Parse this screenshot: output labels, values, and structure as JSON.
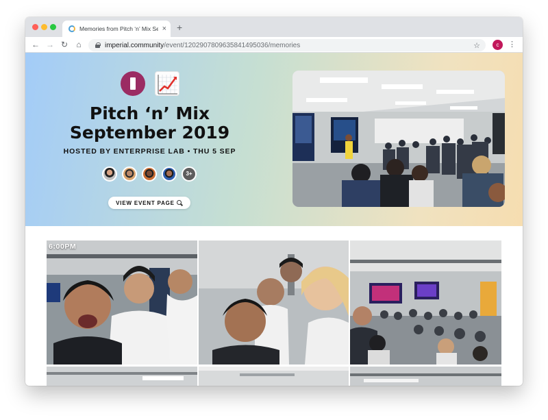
{
  "browser": {
    "tab_title": "Memories from Pitch ‘n’ Mix Se",
    "tab_close": "×",
    "new_tab": "+",
    "url_host": "imperial.community",
    "url_path": "/event/1202907809635841495036/memories",
    "nav": {
      "back": "←",
      "forward": "→",
      "reload": "↻",
      "home": "⌂",
      "star": "☆",
      "menu": "⋮"
    },
    "profile_initial": "c"
  },
  "hero": {
    "title_line1": "Pitch ‘n’ Mix",
    "title_line2": "September 2019",
    "hosted": "HOSTED BY ENTERPRISE LAB • THU 5 SEP",
    "more_attendees": "3+",
    "view_button": "VIEW EVENT PAGE"
  },
  "gallery": {
    "time_label": "6:00PM"
  },
  "colors": {
    "brand": "#9b2c63",
    "hero_gradient_start": "#a3ccf8",
    "hero_gradient_end": "#f6ddb0",
    "profile": "#c2185b"
  },
  "icons": [
    "lock-icon",
    "star-icon",
    "menu-icon",
    "magnify-icon",
    "chart-increasing-icon",
    "back-icon",
    "forward-icon",
    "reload-icon",
    "home-icon"
  ]
}
